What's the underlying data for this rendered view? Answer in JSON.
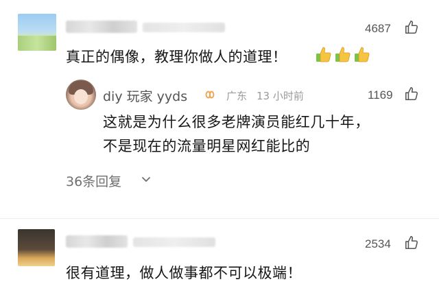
{
  "comments": [
    {
      "text": "真正的偶像，教理你做人的道理！",
      "likes": "4687",
      "emoji": [
        "thumbs-up",
        "thumbs-up",
        "thumbs-up"
      ],
      "reply": {
        "username": "diy 玩家 yyds",
        "location": "广东",
        "time": "13 小时前",
        "likes": "1169",
        "lines": [
          "这就是为什么很多老牌演员能红几十年，",
          "不是现在的流量明星网红能比的"
        ]
      },
      "more_replies": "36条回复"
    },
    {
      "text": "很有道理，做人做事都不可以极端！",
      "likes": "2534"
    }
  ],
  "colors": {
    "accent_badge": "#f0a14a",
    "thumb_yellow": "#f5c542",
    "cuff_green": "#7cc34a"
  },
  "icons": {
    "like": "thumb-up-outline-icon",
    "expand": "chevron-down-icon",
    "user_badge": "infinity-badge-icon"
  }
}
